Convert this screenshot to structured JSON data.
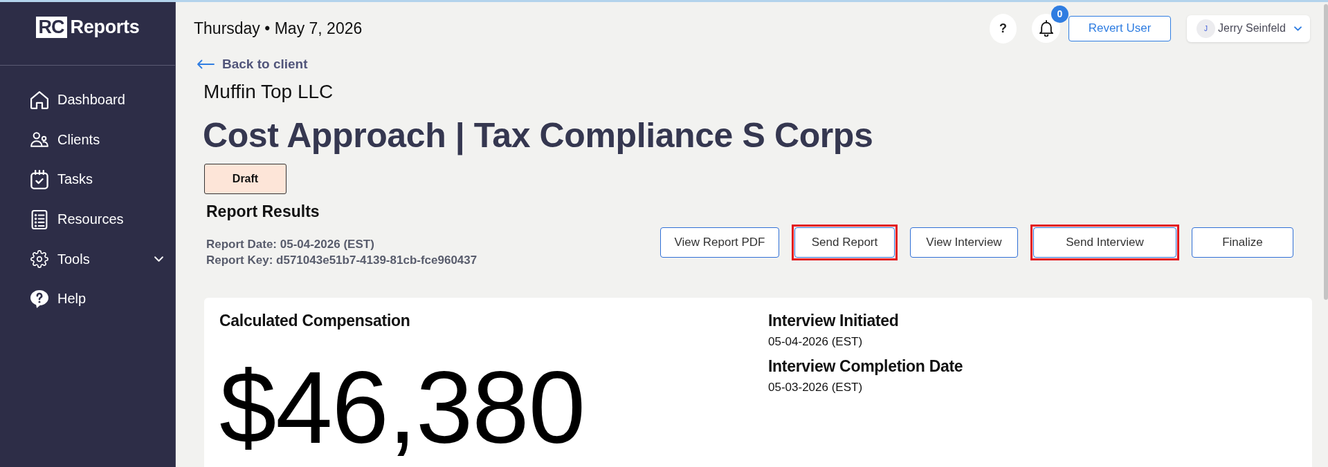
{
  "sidebar": {
    "logo": {
      "mark": "RC",
      "text": "Reports"
    },
    "items": [
      {
        "label": "Dashboard",
        "kind": "link",
        "selected": false
      },
      {
        "label": "Clients",
        "kind": "link",
        "selected": false
      },
      {
        "label": "Tasks",
        "kind": "link",
        "selected": false
      },
      {
        "label": "Resources",
        "kind": "link",
        "selected": false
      },
      {
        "label": "Tools",
        "kind": "dropdown",
        "selected": false
      },
      {
        "label": "Help",
        "kind": "link",
        "selected": false
      }
    ]
  },
  "top_bar": {
    "date": "Thursday • May 7, 2026",
    "help_button": "?",
    "notifications": {
      "count": "0"
    },
    "revert_button": "Revert User",
    "user": {
      "initial": "J",
      "name": "Jerry Seinfeld"
    }
  },
  "page": {
    "back_link": "Back to client",
    "client": "Muffin Top LLC",
    "title": "Cost Approach | Tax Compliance S Corps",
    "status": "Draft"
  },
  "report": {
    "heading": "Report Results",
    "date": "Report Date: 05-04-2026 (EST)",
    "key": "Report Key: d571043e51b7-4139-81cb-fce960437"
  },
  "actions": [
    {
      "label": "View Report PDF",
      "highlighted": false
    },
    {
      "label": "Send Report",
      "highlighted": true
    },
    {
      "label": "View Interview",
      "highlighted": false
    },
    {
      "label": "Send Interview",
      "highlighted": true
    },
    {
      "label": "Finalize",
      "highlighted": false
    }
  ],
  "summary": {
    "compensation_label": "Calculated Compensation",
    "compensation_value": "$46,380",
    "details": [
      {
        "label": "Interview Initiated",
        "value": "05-04-2026 (EST)"
      },
      {
        "label": "Interview Completion Date",
        "value": "05-03-2026 (EST)"
      }
    ]
  }
}
